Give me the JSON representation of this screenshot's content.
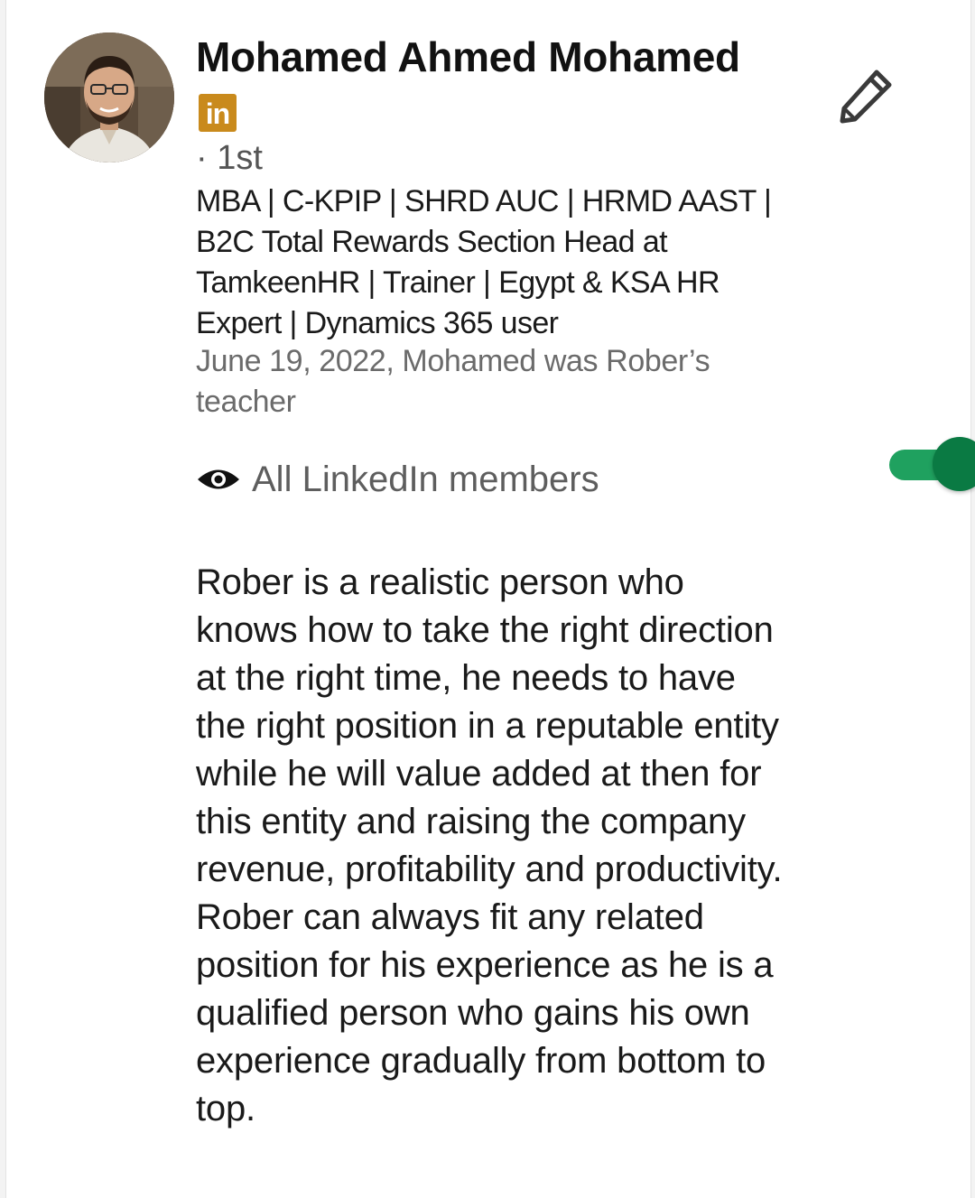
{
  "recommender": {
    "name": "Mohamed Ahmed Mohamed",
    "linkedin_badge_text": "in",
    "degree": "· 1st",
    "headline": "MBA | C-KPIP | SHRD AUC | HRMD AAST | B2C Total Rewards Section Head at TamkeenHR | Trainer | Egypt & KSA HR Expert | Dynamics 365 user",
    "relationship": "June 19, 2022, Mohamed was Rober’s teacher"
  },
  "visibility": {
    "label": "All LinkedIn members",
    "icon": "eye-icon",
    "enabled": true
  },
  "edit": {
    "icon": "pencil-icon"
  },
  "recommendation_text": "Rober is a realistic person who knows how to take the right direction at the right time, he needs to have the right position in a reputable entity while he will value added at then for this entity and raising the company revenue, profitability and productivity. Rober can always fit any related position for his experience as he is a qualified person who gains his own experience gradually from bottom to top.",
  "colors": {
    "toggle_track": "#1fa15f",
    "toggle_knob": "#0a7a43",
    "linkedin_badge": "#c98a1c"
  }
}
